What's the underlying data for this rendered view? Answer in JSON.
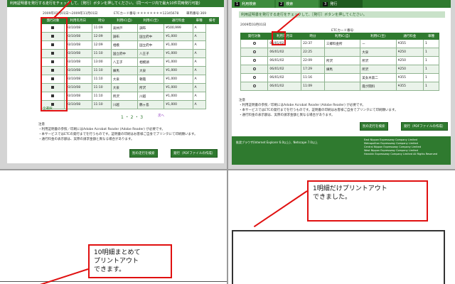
{
  "top_left": {
    "header": "利用証明書を発行する走行をチェックして、［発行］ボタンを押してください。（同一ページ内で最大10件同時発行可能）",
    "period": "2009年02月01日～2009年11月01日",
    "etc_card": "ETCカード番号:＊＊＊＊＊＊＊＊12345678",
    "vehicle_no": "車両番号:369",
    "columns": [
      "発行対象",
      "利用年月日",
      "時分",
      "利用IC(自)",
      "利用IC(至)",
      "通行料金",
      "車種",
      "備考"
    ],
    "rows": [
      [
        "03/10/08",
        "11:09",
        "高井戸",
        "調布",
        "¥500,999",
        "A"
      ],
      [
        "03/10/08",
        "12:09",
        "調布",
        "国立府中",
        "¥1,000",
        "A"
      ],
      [
        "03/10/08",
        "12:09",
        "相模",
        "国立府中",
        "¥1,000",
        "A"
      ],
      [
        "03/10/08",
        "11:10",
        "国立府中",
        "八王子",
        "¥1,000",
        "A"
      ],
      [
        "03/10/08",
        "13:00",
        "八王子",
        "相模湖",
        "¥1,000",
        "A"
      ],
      [
        "03/10/08",
        "11:10",
        "練馬",
        "大泉",
        "¥1,000",
        "A"
      ],
      [
        "03/10/08",
        "11:10",
        "大泉",
        "朝霞",
        "¥1,000",
        "A"
      ],
      [
        "03/10/08",
        "11:10",
        "大泉",
        "所沢",
        "¥1,000",
        "A"
      ],
      [
        "03/10/08",
        "11:10",
        "所沢",
        "川越",
        "¥1,000",
        "A"
      ],
      [
        "03/10/08",
        "11:10",
        "川越",
        "鶴ヶ島",
        "¥1,000",
        "A"
      ]
    ],
    "select_all": "全選択",
    "pager": "1 ・ 2 ・ 3",
    "next_link": "次へ",
    "notes_title": "注意",
    "notes": [
      "・利用証明書の参照／印刷にはAdobe Acrobat Reader (Adobe Reader) が必要です。",
      "・本サービスではETCの発行までを行うものです。証明書の印刷はお客様ご自身でプリンタにて印刷願います。",
      "・通行料金の表示額は、実際の請求金額と異なる場合があります。"
    ],
    "btn_search": "別の走行を検索",
    "btn_issue": "発行（PDFファイルの作成）"
  },
  "top_right": {
    "steps": [
      {
        "num": "1",
        "label": "利用検索"
      },
      {
        "num": "2",
        "label": "検索"
      },
      {
        "num": "3",
        "label": "発行"
      }
    ],
    "header": "利用証明書を発行する走行をチェックして、［発行］ボタンを押してください。",
    "period": "2009年03月01日",
    "etc_card": "ETCカード番号:",
    "columns": [
      "発行対象",
      "利用年月日",
      "時分",
      "利用IC(自)",
      "利用IC(至)",
      "通行料金",
      "車種"
    ],
    "rows": [
      [
        "06/01/02",
        "22:37",
        "三郷料金所",
        "ー",
        "¥355",
        "1"
      ],
      [
        "06/01/02",
        "22:25",
        "",
        "大泉",
        "¥250",
        "1"
      ],
      [
        "06/01/02",
        "22:09",
        "所沢",
        "所沢",
        "¥250",
        "1"
      ],
      [
        "06/01/02",
        "17:29",
        "練馬",
        "所沢",
        "¥250",
        "1"
      ],
      [
        "06/01/02",
        "11:16",
        "",
        "美女木第二",
        "¥355",
        "1"
      ],
      [
        "06/01/02",
        "11:09",
        "",
        "霞が関料",
        "¥355",
        "1"
      ]
    ],
    "notes_title": "注意",
    "notes": [
      "・利用証明書の参照／印刷にはAdobe Acrobat Reader (Adobe Reader) が必要です。",
      "・本サービスではETCの発行までを行うものです。証明書の印刷はお客様ご自身でプリンタにて印刷願います。",
      "・通行料金の表示額は、実際の請求金額と異なる場合があります。"
    ],
    "btn_search": "別の走行を検索",
    "btn_issue": "発行（PDFファイルの作成）",
    "footer_left": "推奨ブラウザ(Internet Explorer 6.0以上)、Netscape 7.0以上",
    "footer_right": [
      "East Nippon Expressway Company Limited",
      "Metropolitan Expressway Company Limited",
      "Central Nippon Expressway Company Limited",
      "West Nippon Expressway Company Limited",
      "Hanshin Expressway Company Limited All Rights Reserved"
    ]
  },
  "bottom_left": {
    "callout": [
      "10明細まとめて",
      "プリントアウト",
      "できます。"
    ]
  },
  "bottom_right": {
    "callout": [
      "1明細だけプリントアウト",
      "できました。"
    ]
  }
}
